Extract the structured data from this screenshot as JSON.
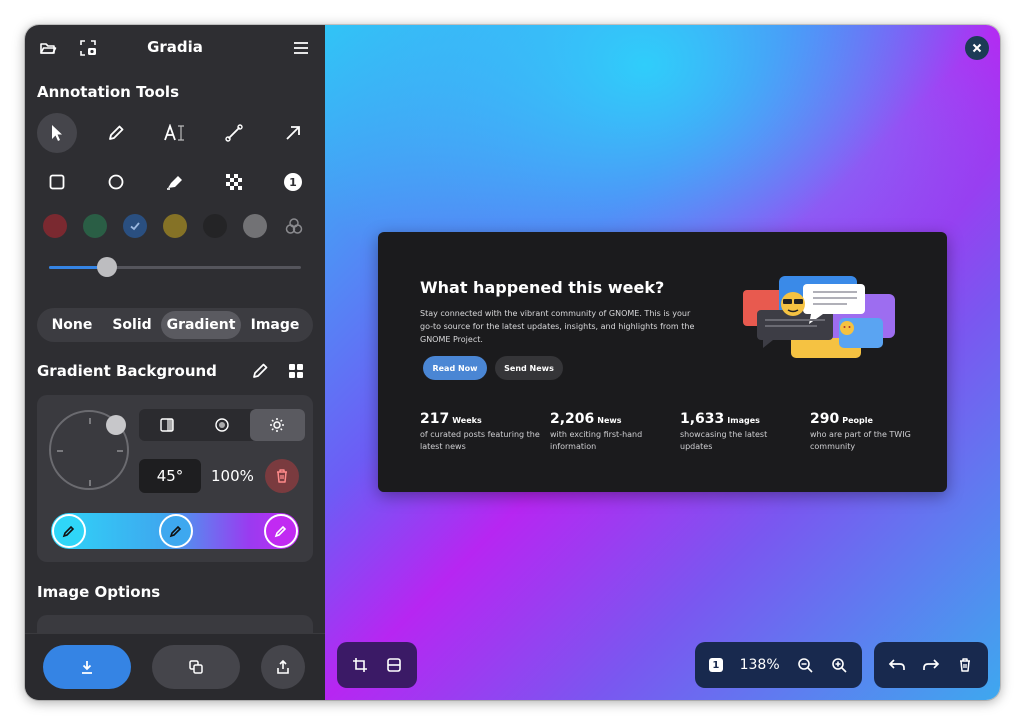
{
  "app": {
    "title": "Gradia"
  },
  "header": {
    "open_icon": "folder-open-icon",
    "screenshot_icon": "screenshot-icon",
    "menu_icon": "hamburger-menu-icon"
  },
  "annotation": {
    "heading": "Annotation Tools",
    "tools_row1": [
      "select-tool",
      "pen-tool",
      "text-tool",
      "line-tool",
      "arrow-tool"
    ],
    "tools_row2": [
      "rectangle-tool",
      "circle-tool",
      "highlighter-tool",
      "pixelate-tool",
      "number-tool"
    ],
    "number_tool_label": "1",
    "colors": [
      "#7a2930",
      "#2a5e45",
      "#2a4f80",
      "#857226",
      "#242426",
      "#727275"
    ],
    "selected_color_index": 2,
    "size_level": 0.23
  },
  "background_modes": {
    "items": [
      "None",
      "Solid",
      "Gradient",
      "Image"
    ],
    "active": "Gradient"
  },
  "gradient": {
    "heading": "Gradient Background",
    "angle": "45°",
    "opacity": "100%",
    "stops": [
      "#2fd6f8",
      "#3ea8ef",
      "#c12af2"
    ],
    "colors": {
      "start": "#2fd6f8",
      "end": "#c12af2"
    }
  },
  "image_options": {
    "heading": "Image Options"
  },
  "footer": {
    "save_icon": "download-icon",
    "copy_icon": "copy-icon",
    "share_icon": "share-icon",
    "accent": "#3584e4"
  },
  "preview": {
    "title": "What happened this week?",
    "description": "Stay connected with the vibrant community of GNOME. This is your go-to source for the latest updates, insights, and highlights from the GNOME Project.",
    "btn_primary": "Read Now",
    "btn_secondary": "Send News",
    "stats": [
      {
        "num": "217",
        "unit": "Weeks",
        "desc": "of curated posts featuring the latest news"
      },
      {
        "num": "2,206",
        "unit": "News",
        "desc": "with exciting first-hand information"
      },
      {
        "num": "1,633",
        "unit": "Images",
        "desc": "showcasing the latest updates"
      },
      {
        "num": "290",
        "unit": "People",
        "desc": "who are part of the TWIG community"
      }
    ]
  },
  "canvas_toolbar": {
    "zoom_badge": "1",
    "zoom": "138%",
    "left_tools": [
      "crop-icon",
      "crop-adjust-icon"
    ],
    "right_tools": [
      "undo-icon",
      "redo-icon",
      "delete-icon"
    ]
  }
}
